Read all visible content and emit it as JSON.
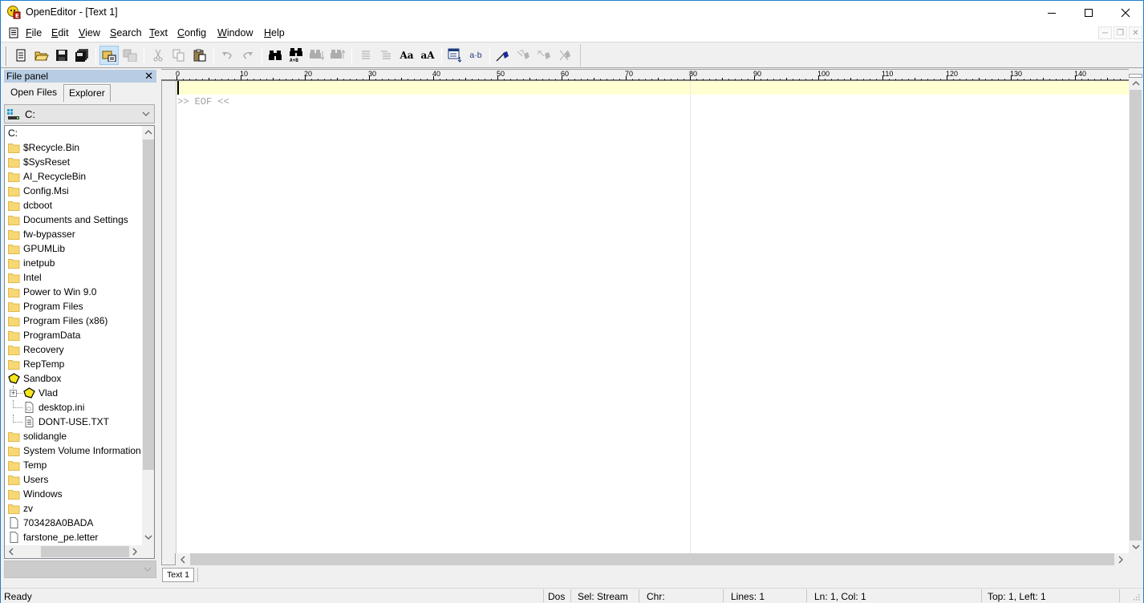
{
  "window": {
    "title": "OpenEditor - [Text 1]",
    "controls": {
      "minimize": "minimize",
      "maximize": "maximize",
      "close": "close"
    }
  },
  "menu": {
    "items": [
      {
        "label": "File",
        "accel": "F",
        "rest": "ile"
      },
      {
        "label": "Edit",
        "accel": "E",
        "rest": "dit"
      },
      {
        "label": "View",
        "accel": "V",
        "rest": "iew"
      },
      {
        "label": "Search",
        "accel": "S",
        "rest": "earch"
      },
      {
        "label": "Text",
        "accel": "T",
        "rest": "ext"
      },
      {
        "label": "Config",
        "accel": "C",
        "rest": "onfig"
      },
      {
        "label": "Window",
        "accel": "W",
        "rest": "indow"
      },
      {
        "label": "Help",
        "accel": "H",
        "rest": "elp"
      }
    ]
  },
  "toolbar": {
    "buttons": [
      {
        "name": "new",
        "enabled": true
      },
      {
        "name": "open",
        "enabled": true
      },
      {
        "name": "save",
        "enabled": true
      },
      {
        "name": "save-all",
        "enabled": true
      },
      {
        "name": "file-panel-toggle",
        "enabled": true,
        "active": true
      },
      {
        "name": "compare",
        "enabled": false
      },
      {
        "name": "cut",
        "enabled": false
      },
      {
        "name": "copy",
        "enabled": false
      },
      {
        "name": "paste",
        "enabled": true
      },
      {
        "name": "undo",
        "enabled": false
      },
      {
        "name": "redo",
        "enabled": false
      },
      {
        "name": "find",
        "enabled": true
      },
      {
        "name": "replace",
        "enabled": true,
        "sublabel": "A+B"
      },
      {
        "name": "find-next",
        "enabled": false
      },
      {
        "name": "find-previous",
        "enabled": false
      },
      {
        "name": "indent",
        "enabled": false
      },
      {
        "name": "outdent",
        "enabled": false
      },
      {
        "name": "lowercase",
        "enabled": true,
        "label": "Aa"
      },
      {
        "name": "uppercase",
        "enabled": true,
        "label": "aA"
      },
      {
        "name": "select-block",
        "enabled": true
      },
      {
        "name": "word-wrap",
        "enabled": true,
        "label": "a·b"
      },
      {
        "name": "toggle-bookmark",
        "enabled": true
      },
      {
        "name": "next-bookmark",
        "enabled": false
      },
      {
        "name": "previous-bookmark",
        "enabled": false
      },
      {
        "name": "clear-bookmarks",
        "enabled": false
      }
    ]
  },
  "file_panel": {
    "title": "File panel",
    "tabs": [
      {
        "label": "Open Files",
        "selected": false
      },
      {
        "label": "Explorer",
        "selected": true
      }
    ],
    "drive": "C:",
    "root": "C:",
    "tree": [
      {
        "label": "$Recycle.Bin",
        "type": "folder",
        "depth": 0
      },
      {
        "label": "$SysReset",
        "type": "folder",
        "depth": 0
      },
      {
        "label": "AI_RecycleBin",
        "type": "folder",
        "depth": 0
      },
      {
        "label": "Config.Msi",
        "type": "folder",
        "depth": 0
      },
      {
        "label": "dcboot",
        "type": "folder",
        "depth": 0
      },
      {
        "label": "Documents and Settings",
        "type": "folder",
        "depth": 0
      },
      {
        "label": "fw-bypasser",
        "type": "folder",
        "depth": 0
      },
      {
        "label": "GPUMLib",
        "type": "folder",
        "depth": 0
      },
      {
        "label": "inetpub",
        "type": "folder",
        "depth": 0
      },
      {
        "label": "Intel",
        "type": "folder",
        "depth": 0
      },
      {
        "label": "Power to Win 9.0",
        "type": "folder",
        "depth": 0
      },
      {
        "label": "Program Files",
        "type": "folder",
        "depth": 0
      },
      {
        "label": "Program Files (x86)",
        "type": "folder",
        "depth": 0
      },
      {
        "label": "ProgramData",
        "type": "folder",
        "depth": 0
      },
      {
        "label": "Recovery",
        "type": "folder",
        "depth": 0
      },
      {
        "label": "RepTemp",
        "type": "folder",
        "depth": 0
      },
      {
        "label": "Sandbox",
        "type": "special-folder",
        "depth": 0
      },
      {
        "label": "Vlad",
        "type": "special-folder",
        "depth": 1,
        "expandable": true
      },
      {
        "label": "desktop.ini",
        "type": "ini-file",
        "depth": 1
      },
      {
        "label": "DONT-USE.TXT",
        "type": "text-file",
        "depth": 1
      },
      {
        "label": "solidangle",
        "type": "folder",
        "depth": 0
      },
      {
        "label": "System Volume Information",
        "type": "folder",
        "depth": 0
      },
      {
        "label": "Temp",
        "type": "folder",
        "depth": 0
      },
      {
        "label": "Users",
        "type": "folder",
        "depth": 0
      },
      {
        "label": "Windows",
        "type": "folder",
        "depth": 0
      },
      {
        "label": "zv",
        "type": "folder",
        "depth": 0
      },
      {
        "label": "703428A0BADA",
        "type": "file",
        "depth": 0
      },
      {
        "label": "farstone_pe.letter",
        "type": "file",
        "depth": 0
      }
    ],
    "filter": ""
  },
  "editor": {
    "ruler_labels": [
      "0",
      "10",
      "20",
      "30",
      "40",
      "50",
      "60",
      "70",
      "80",
      "90",
      "100",
      "110",
      "120",
      "130",
      "140"
    ],
    "content": "",
    "eof_marker": ">> EOF <<",
    "right_margin_column": 80,
    "tabs": [
      {
        "label": "Text 1",
        "selected": true
      }
    ]
  },
  "status": {
    "message": "Ready",
    "line_endings": "Dos",
    "selection_mode": "Sel: Stream",
    "char": "Chr:",
    "lines": "Lines: 1",
    "position": "Ln: 1, Col: 1",
    "top_left": "Top: 1, Left: 1"
  },
  "colors": {
    "current_line": "#ffffd2",
    "panel_header": "#b8cde3",
    "window_border": "#1f7fcf",
    "folder": "#f8d775"
  }
}
